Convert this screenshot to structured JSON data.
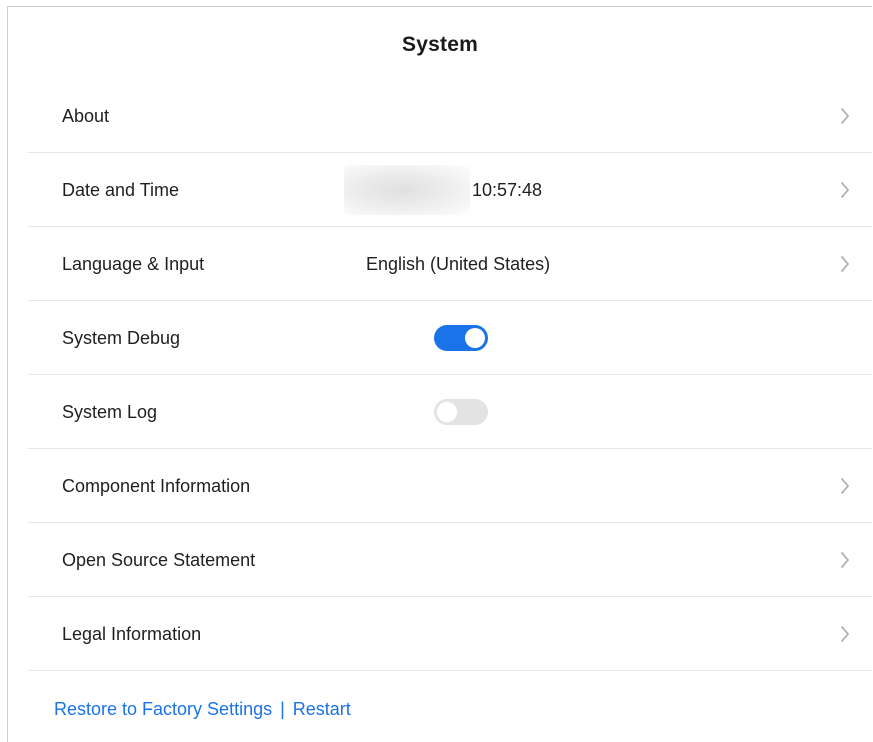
{
  "header": {
    "title": "System"
  },
  "rows": [
    {
      "label": "About",
      "type": "nav"
    },
    {
      "label": "Date and Time",
      "value": "10:57:48",
      "type": "nav",
      "redacted_prefix": true
    },
    {
      "label": "Language & Input",
      "value": "English (United States)",
      "type": "nav"
    },
    {
      "label": "System Debug",
      "type": "toggle",
      "toggle_state": "on"
    },
    {
      "label": "System Log",
      "type": "toggle",
      "toggle_state": "off"
    },
    {
      "label": "Component Information",
      "type": "nav"
    },
    {
      "label": "Open Source Statement",
      "type": "nav"
    },
    {
      "label": "Legal Information",
      "type": "nav"
    }
  ],
  "footer": {
    "restore_label": "Restore to Factory Settings",
    "separator": "|",
    "restart_label": "Restart"
  },
  "colors": {
    "accent": "#1a73e8",
    "toggle_off": "#e3e3e3",
    "divider": "#e6e6e6",
    "chevron": "#b3b3b3"
  },
  "icons": {
    "chevron": "chevron-right-icon"
  }
}
